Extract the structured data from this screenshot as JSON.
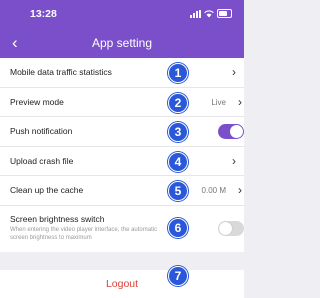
{
  "status_bar": {
    "time": "13:28"
  },
  "nav": {
    "back_icon": "‹",
    "title": "App setting"
  },
  "rows": [
    {
      "label": "Mobile data traffic statistics",
      "badge": "1"
    },
    {
      "label": "Preview mode",
      "value": "Live",
      "badge": "2"
    },
    {
      "label": "Push notification",
      "badge": "3",
      "toggle": "on"
    },
    {
      "label": "Upload crash file",
      "badge": "4"
    },
    {
      "label": "Clean up the cache",
      "value": "0.00 M",
      "badge": "5"
    },
    {
      "label": "Screen brightness switch",
      "description": "When entering the video player interface, the automatic screen brightness to maximum",
      "badge": "6",
      "toggle": "off"
    }
  ],
  "logout": {
    "label": "Logout",
    "badge": "7"
  },
  "colors": {
    "primary": "#7b4fc9",
    "badge": "#2a58d8",
    "logout": "#e0413a"
  }
}
